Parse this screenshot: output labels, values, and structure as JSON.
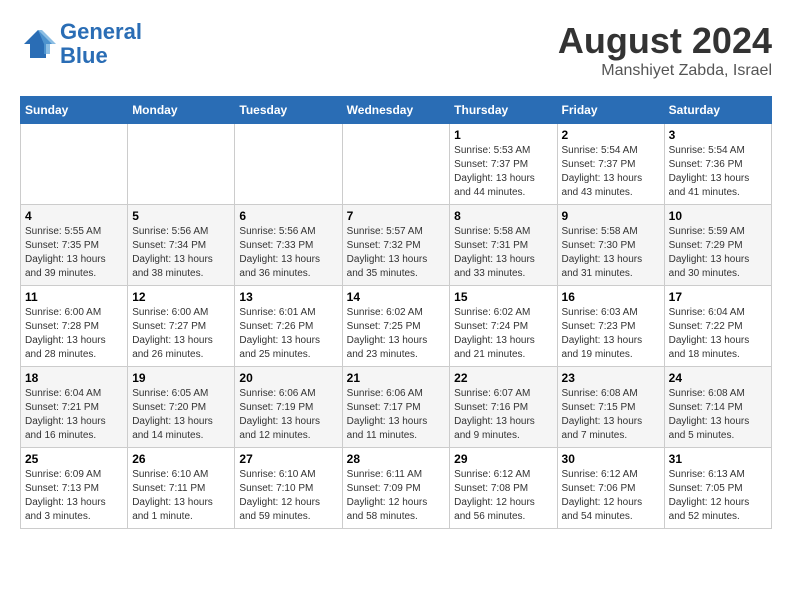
{
  "logo": {
    "line1": "General",
    "line2": "Blue"
  },
  "title": {
    "month_year": "August 2024",
    "location": "Manshiyet Zabda, Israel"
  },
  "header": {
    "days": [
      "Sunday",
      "Monday",
      "Tuesday",
      "Wednesday",
      "Thursday",
      "Friday",
      "Saturday"
    ]
  },
  "weeks": [
    [
      {
        "day": "",
        "info": ""
      },
      {
        "day": "",
        "info": ""
      },
      {
        "day": "",
        "info": ""
      },
      {
        "day": "",
        "info": ""
      },
      {
        "day": "1",
        "info": "Sunrise: 5:53 AM\nSunset: 7:37 PM\nDaylight: 13 hours\nand 44 minutes."
      },
      {
        "day": "2",
        "info": "Sunrise: 5:54 AM\nSunset: 7:37 PM\nDaylight: 13 hours\nand 43 minutes."
      },
      {
        "day": "3",
        "info": "Sunrise: 5:54 AM\nSunset: 7:36 PM\nDaylight: 13 hours\nand 41 minutes."
      }
    ],
    [
      {
        "day": "4",
        "info": "Sunrise: 5:55 AM\nSunset: 7:35 PM\nDaylight: 13 hours\nand 39 minutes."
      },
      {
        "day": "5",
        "info": "Sunrise: 5:56 AM\nSunset: 7:34 PM\nDaylight: 13 hours\nand 38 minutes."
      },
      {
        "day": "6",
        "info": "Sunrise: 5:56 AM\nSunset: 7:33 PM\nDaylight: 13 hours\nand 36 minutes."
      },
      {
        "day": "7",
        "info": "Sunrise: 5:57 AM\nSunset: 7:32 PM\nDaylight: 13 hours\nand 35 minutes."
      },
      {
        "day": "8",
        "info": "Sunrise: 5:58 AM\nSunset: 7:31 PM\nDaylight: 13 hours\nand 33 minutes."
      },
      {
        "day": "9",
        "info": "Sunrise: 5:58 AM\nSunset: 7:30 PM\nDaylight: 13 hours\nand 31 minutes."
      },
      {
        "day": "10",
        "info": "Sunrise: 5:59 AM\nSunset: 7:29 PM\nDaylight: 13 hours\nand 30 minutes."
      }
    ],
    [
      {
        "day": "11",
        "info": "Sunrise: 6:00 AM\nSunset: 7:28 PM\nDaylight: 13 hours\nand 28 minutes."
      },
      {
        "day": "12",
        "info": "Sunrise: 6:00 AM\nSunset: 7:27 PM\nDaylight: 13 hours\nand 26 minutes."
      },
      {
        "day": "13",
        "info": "Sunrise: 6:01 AM\nSunset: 7:26 PM\nDaylight: 13 hours\nand 25 minutes."
      },
      {
        "day": "14",
        "info": "Sunrise: 6:02 AM\nSunset: 7:25 PM\nDaylight: 13 hours\nand 23 minutes."
      },
      {
        "day": "15",
        "info": "Sunrise: 6:02 AM\nSunset: 7:24 PM\nDaylight: 13 hours\nand 21 minutes."
      },
      {
        "day": "16",
        "info": "Sunrise: 6:03 AM\nSunset: 7:23 PM\nDaylight: 13 hours\nand 19 minutes."
      },
      {
        "day": "17",
        "info": "Sunrise: 6:04 AM\nSunset: 7:22 PM\nDaylight: 13 hours\nand 18 minutes."
      }
    ],
    [
      {
        "day": "18",
        "info": "Sunrise: 6:04 AM\nSunset: 7:21 PM\nDaylight: 13 hours\nand 16 minutes."
      },
      {
        "day": "19",
        "info": "Sunrise: 6:05 AM\nSunset: 7:20 PM\nDaylight: 13 hours\nand 14 minutes."
      },
      {
        "day": "20",
        "info": "Sunrise: 6:06 AM\nSunset: 7:19 PM\nDaylight: 13 hours\nand 12 minutes."
      },
      {
        "day": "21",
        "info": "Sunrise: 6:06 AM\nSunset: 7:17 PM\nDaylight: 13 hours\nand 11 minutes."
      },
      {
        "day": "22",
        "info": "Sunrise: 6:07 AM\nSunset: 7:16 PM\nDaylight: 13 hours\nand 9 minutes."
      },
      {
        "day": "23",
        "info": "Sunrise: 6:08 AM\nSunset: 7:15 PM\nDaylight: 13 hours\nand 7 minutes."
      },
      {
        "day": "24",
        "info": "Sunrise: 6:08 AM\nSunset: 7:14 PM\nDaylight: 13 hours\nand 5 minutes."
      }
    ],
    [
      {
        "day": "25",
        "info": "Sunrise: 6:09 AM\nSunset: 7:13 PM\nDaylight: 13 hours\nand 3 minutes."
      },
      {
        "day": "26",
        "info": "Sunrise: 6:10 AM\nSunset: 7:11 PM\nDaylight: 13 hours\nand 1 minute."
      },
      {
        "day": "27",
        "info": "Sunrise: 6:10 AM\nSunset: 7:10 PM\nDaylight: 12 hours\nand 59 minutes."
      },
      {
        "day": "28",
        "info": "Sunrise: 6:11 AM\nSunset: 7:09 PM\nDaylight: 12 hours\nand 58 minutes."
      },
      {
        "day": "29",
        "info": "Sunrise: 6:12 AM\nSunset: 7:08 PM\nDaylight: 12 hours\nand 56 minutes."
      },
      {
        "day": "30",
        "info": "Sunrise: 6:12 AM\nSunset: 7:06 PM\nDaylight: 12 hours\nand 54 minutes."
      },
      {
        "day": "31",
        "info": "Sunrise: 6:13 AM\nSunset: 7:05 PM\nDaylight: 12 hours\nand 52 minutes."
      }
    ]
  ]
}
